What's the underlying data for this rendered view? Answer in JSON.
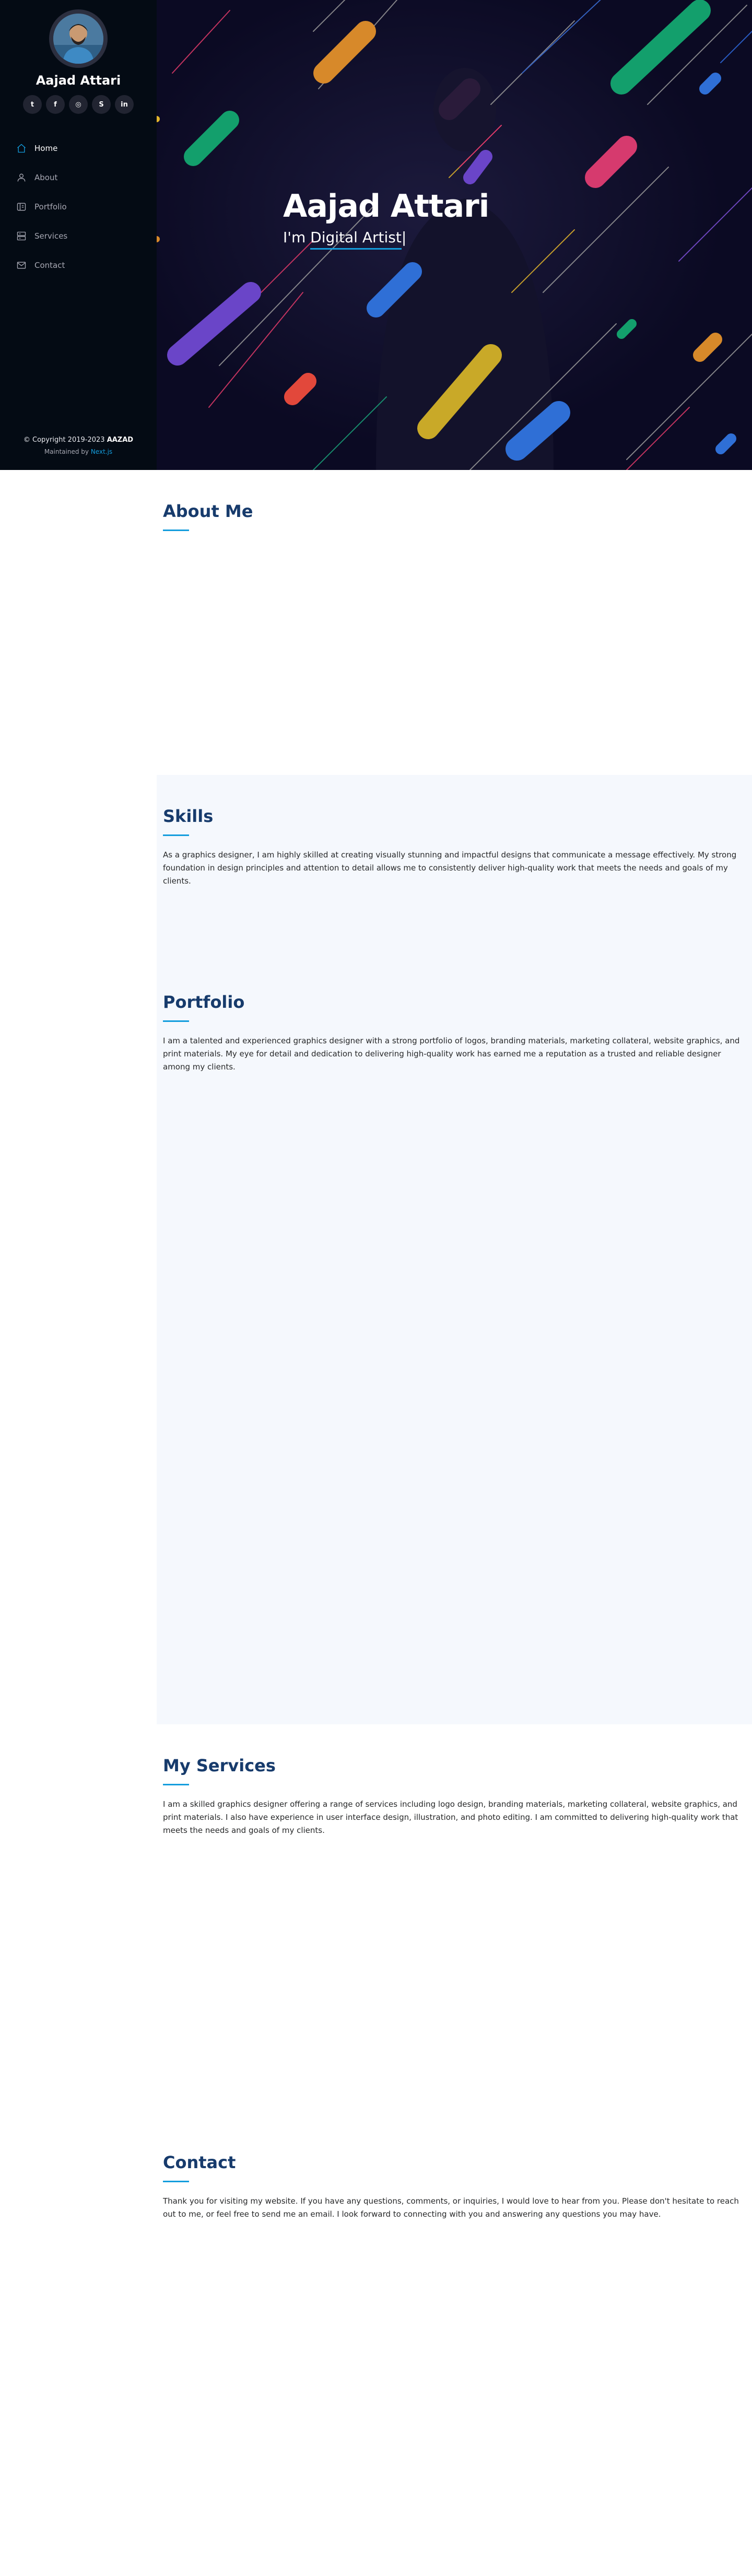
{
  "sidebar": {
    "name": "Aajad Attari",
    "social": [
      {
        "icon": "twitter-icon",
        "glyph": "t"
      },
      {
        "icon": "facebook-icon",
        "glyph": "f"
      },
      {
        "icon": "instagram-icon",
        "glyph": "◎"
      },
      {
        "icon": "skype-icon",
        "glyph": "S"
      },
      {
        "icon": "linkedin-icon",
        "glyph": "in"
      }
    ],
    "nav": [
      {
        "label": "Home",
        "icon": "home-icon",
        "active": true
      },
      {
        "label": "About",
        "icon": "user-icon",
        "active": false
      },
      {
        "label": "Portfolio",
        "icon": "book-icon",
        "active": false
      },
      {
        "label": "Services",
        "icon": "server-icon",
        "active": false
      },
      {
        "label": "Contact",
        "icon": "envelope-icon",
        "active": false
      }
    ],
    "copyright_prefix": "© Copyright 2019-2023",
    "copyright_brand": "AAZAD",
    "maintained_prefix": "Maintained by",
    "maintained_link": "Next.js"
  },
  "hero": {
    "title": "Aajad Attari",
    "sub_prefix": "I'm",
    "sub_typed": "Digital Artist"
  },
  "about": {
    "title": "About Me"
  },
  "skills": {
    "title": "Skills",
    "text": "As a graphics designer, I am highly skilled at creating visually stunning and impactful designs that communicate a message effectively. My strong foundation in design principles and attention to detail allows me to consistently deliver high-quality work that meets the needs and goals of my clients."
  },
  "portfolio": {
    "title": "Portfolio",
    "text": "I am a talented and experienced graphics designer with a strong portfolio of logos, branding materials, marketing collateral, website graphics, and print materials. My eye for detail and dedication to delivering high-quality work has earned me a reputation as a trusted and reliable designer among my clients."
  },
  "services": {
    "title": "My Services",
    "text": "I am a skilled graphics designer offering a range of services including logo design, branding materials, marketing collateral, website graphics, and print materials. I also have experience in user interface design, illustration, and photo editing. I am committed to delivering high-quality work that meets the needs and goals of my clients."
  },
  "contact": {
    "title": "Contact",
    "text": "Thank you for visiting my website. If you have any questions, comments, or inquiries, I would love to hear from you. Please don't hesitate to reach out to me, or feel free to send me an email. I look forward to connecting with you and answering any questions you may have."
  },
  "colors": {
    "accent": "#149ddd",
    "sidebar": "#040b14",
    "heading": "#173b6c",
    "alt_bg": "#f5f8fd",
    "hero_bg": "#0b0a23"
  }
}
